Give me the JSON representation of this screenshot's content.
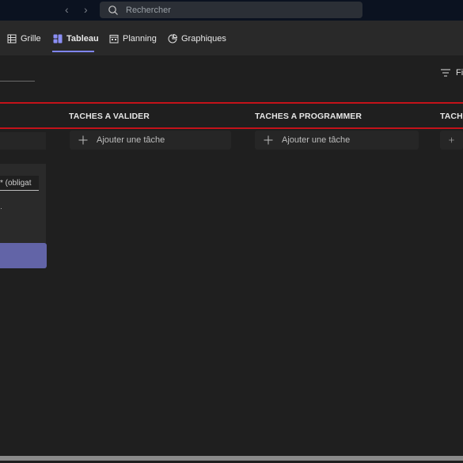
{
  "titlebar": {
    "back_icon": "chevron-left-icon",
    "forward_icon": "chevron-right-icon",
    "search": {
      "placeholder": "Rechercher",
      "icon": "search-icon"
    }
  },
  "tabs": [
    {
      "label": "Grille",
      "icon": "grid-icon",
      "active": false
    },
    {
      "label": "Tableau",
      "icon": "board-icon",
      "active": true
    },
    {
      "label": "Planning",
      "icon": "calendar-icon",
      "active": false
    },
    {
      "label": "Graphiques",
      "icon": "chart-icon",
      "active": false
    }
  ],
  "toolbar": {
    "filter_label": "Fi",
    "filter_icon": "filter-icon"
  },
  "buckets": [
    {
      "title": "TACHES A VALIDER",
      "add_label": "Ajouter une tâche"
    },
    {
      "title": "TACHES A PROGRAMMER",
      "add_label": "Ajouter une tâche"
    },
    {
      "title": "TACHE"
    }
  ],
  "new_task": {
    "name_placeholder": "* (obligat",
    "mark": "·"
  },
  "colors": {
    "accent": "#7f85f5",
    "primary_button": "#6264a7",
    "highlight": "#c4121a",
    "background": "#1f1f1f",
    "tabbar": "#292929",
    "titlebar": "#0b1220"
  }
}
